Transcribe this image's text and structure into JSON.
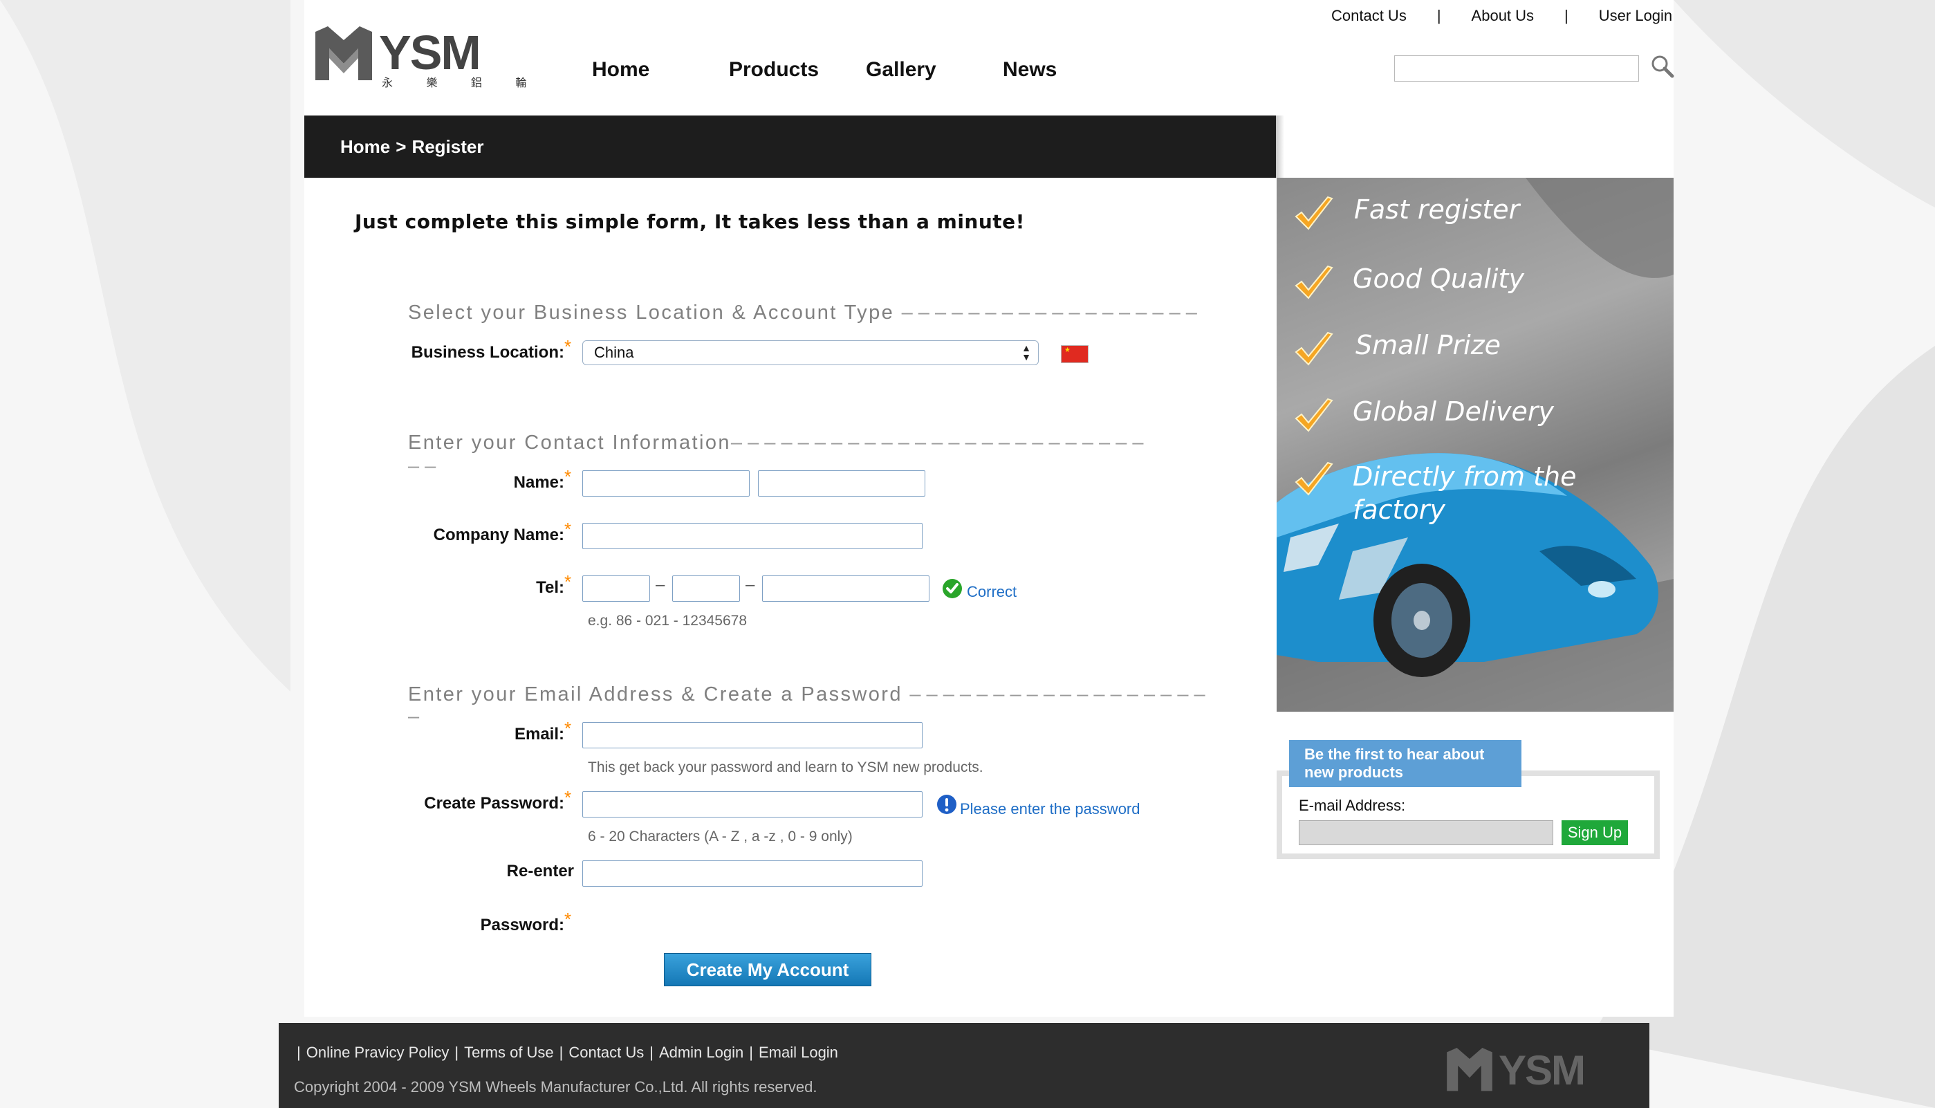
{
  "header": {
    "logo_text": "YSM",
    "logo_sub": "永 樂 鋁 輪",
    "top_links": [
      "Contact Us",
      "|",
      "About Us",
      "|",
      "User Login"
    ],
    "nav": [
      "Home",
      "Products",
      "Gallery",
      "News"
    ],
    "search_placeholder": ""
  },
  "breadcrumb": {
    "home": "Home",
    "sep": ">",
    "current": "Register"
  },
  "form": {
    "intro": "Just complete this simple form, It takes less than a minute!",
    "section1": "Select your Business Location & Account Type",
    "section1_dash": "– – – – – – – – – – – – – – – – – –",
    "business_location_label": "Business Location:",
    "business_location_value": "China",
    "section2": "Enter your Contact Information",
    "section2_dash": "– – – – – – – – – – – – – – – – – – – – – – – – –",
    "section2_dash2": "– –",
    "name_label": "Name:",
    "company_label": "Company Name:",
    "tel_label": "Tel:",
    "tel_sep": "–",
    "tel_status": "Correct",
    "tel_hint": "e.g. 86 - 021 - 12345678",
    "section3": "Enter your Email Address & Create a Password",
    "section3_dash": "– – – – – – – – – – – – – – – – – –",
    "section3_dash2": "–",
    "email_label": "Email:",
    "email_hint": "This get back your password and learn to YSM new products.",
    "password_label": "Create Password:",
    "password_status": "Please enter the password",
    "password_hint": "6 - 20 Characters (A - Z , a -z , 0 - 9 only)",
    "reenter_label1": "Re-enter",
    "reenter_label2": "Password:",
    "submit": "Create My Account",
    "required_mark": "*"
  },
  "sidebar": {
    "benefits": [
      "Fast register",
      "Good Quality",
      "Small Prize",
      "Global Delivery",
      "Directly from the",
      "factory"
    ],
    "newsletter_title1": "Be the first to hear about",
    "newsletter_title2": "new products",
    "email_label": "E-mail Address:",
    "signup": "Sign Up"
  },
  "footer": {
    "links": [
      "|",
      "Online Pravicy Policy",
      "|",
      "Terms of Use",
      "|",
      "Contact Us",
      "|",
      "Admin Login",
      "|",
      "Email Login"
    ],
    "copyright": "Copyright 2004 - 2009 YSM Wheels Manufacturer Co.,Ltd. All rights reserved.",
    "logo_text": "YSM"
  },
  "colors": {
    "accent_orange": "#ff8a00",
    "link_blue": "#1f6ec6",
    "button_blue": "#1a7fc0",
    "signup_green": "#1fa83a",
    "dark_bar": "#1d1d1d"
  }
}
